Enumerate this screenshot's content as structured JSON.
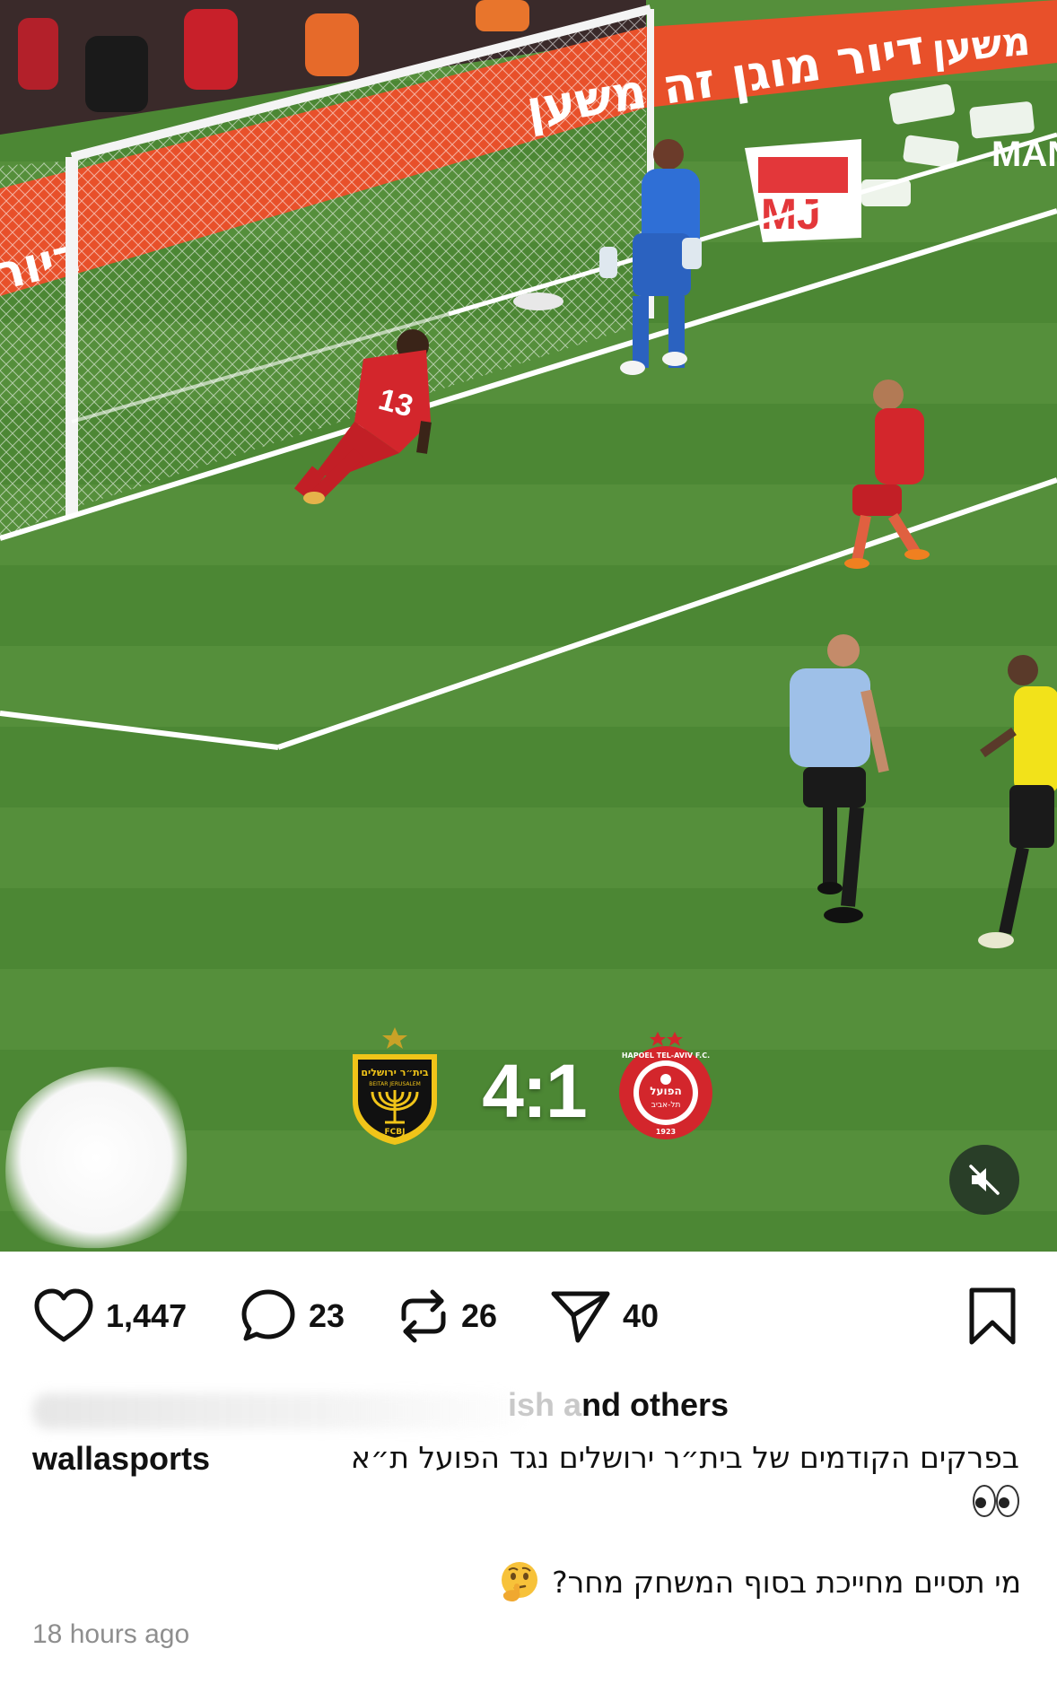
{
  "video": {
    "score": "4:1",
    "home_crest": "beitar-jerusalem-crest",
    "home_crest_text_top": "בית״ר ירושלים",
    "home_crest_text_sub": "BEITAR JERUSALEM",
    "home_crest_text_bottom": "FCBJ",
    "away_crest": "hapoel-tel-aviv-crest",
    "away_crest_text_top": "HAPOEL TEL-AVIV F.C.",
    "away_crest_text_mid": "הפועל",
    "away_crest_text_sub": "תל-אביב",
    "away_crest_text_year": "1923",
    "ad_board_text": "דיור מוגן זה משען",
    "mute_icon": "speaker-muted-icon",
    "jersey_number": "13"
  },
  "actions": {
    "like_icon": "heart-icon",
    "like_count": "1,447",
    "comment_icon": "comment-bubble-icon",
    "comment_count": "23",
    "repost_icon": "repost-arrows-icon",
    "repost_count": "26",
    "share_icon": "send-icon",
    "share_count": "40",
    "save_icon": "bookmark-icon"
  },
  "likes": {
    "partial_text": "ish",
    "suffix_faded": "a",
    "suffix": "nd others"
  },
  "post": {
    "username": "wallasports",
    "caption_line1": "בפרקים הקודמים של בית״ר ירושלים נגד הפועל ת״א",
    "caption_emoji": "eyes-emoji",
    "question": "מי תסיים מחייכת בסוף המשחק מחר?",
    "question_emoji": "thinking-face-emoji",
    "timestamp": "18 hours ago"
  },
  "colors": {
    "pitch": "#4f8a37",
    "ad_board": "#e8502a",
    "home_kit": "#d3262c",
    "keeper_kit": "#2f6fd6",
    "referee_kit": "#9ec0e8",
    "away_kit": "#f2e21a",
    "text": "#111111",
    "muted_text": "#8e8e8e"
  }
}
